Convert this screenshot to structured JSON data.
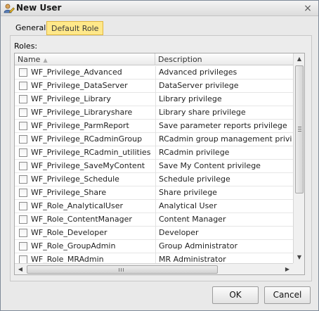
{
  "window": {
    "title": "New User",
    "icon": "user-pen-icon",
    "close": "×"
  },
  "tabs": [
    {
      "label": "General",
      "active": false
    },
    {
      "label": "Default Role",
      "active": true
    }
  ],
  "roles": {
    "label": "Roles:",
    "columns": {
      "name": "Name",
      "description": "Description"
    },
    "rows": [
      {
        "name": "WF_Privilege_Advanced",
        "description": "Advanced privileges",
        "checked": false
      },
      {
        "name": "WF_Privilege_DataServer",
        "description": "DataServer privilege",
        "checked": false
      },
      {
        "name": "WF_Privilege_Library",
        "description": "Library privilege",
        "checked": false
      },
      {
        "name": "WF_Privilege_Libraryshare",
        "description": "Library share privilege",
        "checked": false
      },
      {
        "name": "WF_Privilege_ParmReport",
        "description": "Save parameter reports privilege",
        "checked": false
      },
      {
        "name": "WF_Privilege_RCadminGroup",
        "description": "RCadmin group management privilege",
        "checked": false
      },
      {
        "name": "WF_Privilege_RCadmin_utilities",
        "description": "RCadmin privilege",
        "checked": false
      },
      {
        "name": "WF_Privilege_SaveMyContent",
        "description": "Save My Content privilege",
        "checked": false
      },
      {
        "name": "WF_Privilege_Schedule",
        "description": "Schedule privilege",
        "checked": false
      },
      {
        "name": "WF_Privilege_Share",
        "description": "Share privilege",
        "checked": false
      },
      {
        "name": "WF_Role_AnalyticalUser",
        "description": "Analytical User",
        "checked": false
      },
      {
        "name": "WF_Role_ContentManager",
        "description": "Content Manager",
        "checked": false
      },
      {
        "name": "WF_Role_Developer",
        "description": "Developer",
        "checked": false
      },
      {
        "name": "WF_Role_GroupAdmin",
        "description": "Group Administrator",
        "checked": false
      },
      {
        "name": "WF_Role_MRAdmin",
        "description": "MR Administrator",
        "checked": false
      }
    ]
  },
  "buttons": {
    "ok": "OK",
    "cancel": "Cancel"
  },
  "colors": {
    "active_tab": "#ffe88a",
    "dialog_bg": "#e9e9e9"
  }
}
